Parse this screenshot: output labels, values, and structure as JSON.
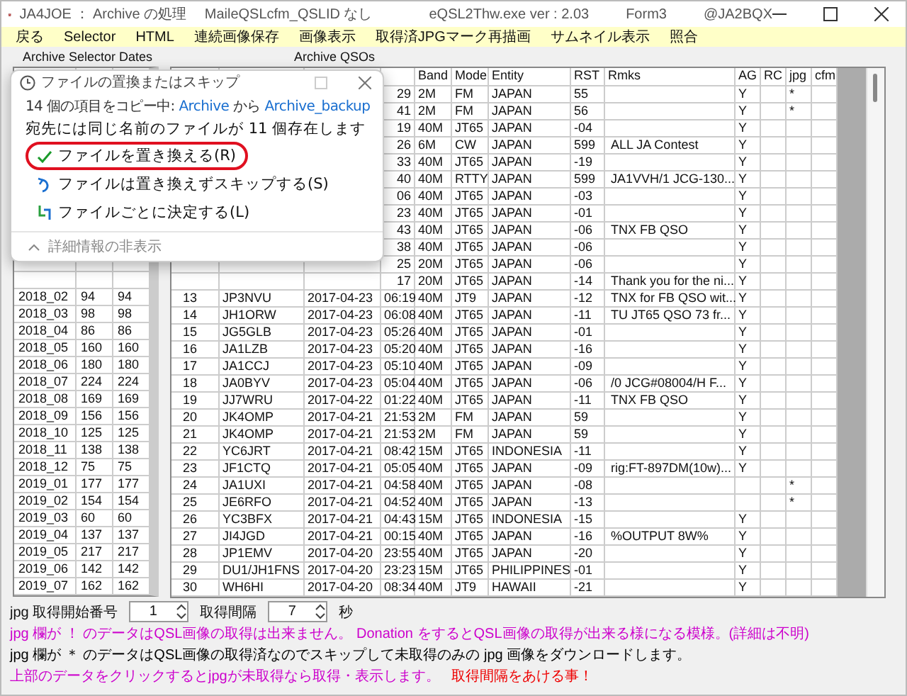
{
  "window": {
    "title_parts": [
      "JA4JOE ： Archive の処理 　MaileQSLcfm_QSLID なし",
      "eQSL2Thw.exe  ver : 2.03",
      "Form3",
      "@JA2BQX"
    ]
  },
  "menu": [
    "戻る",
    "Selector",
    "HTML",
    "連続画像保存",
    "画像表示",
    "取得済JPGマーク再描画",
    "サムネイル表示",
    "照合"
  ],
  "panel_labels": [
    "Archive Selector Dates",
    "Archive QSOs"
  ],
  "dates_table": {
    "rows": [
      [
        "2018_02",
        "94",
        "94"
      ],
      [
        "2018_03",
        "98",
        "98"
      ],
      [
        "2018_04",
        "86",
        "86"
      ],
      [
        "2018_05",
        "160",
        "160"
      ],
      [
        "2018_06",
        "180",
        "180"
      ],
      [
        "2018_07",
        "224",
        "224"
      ],
      [
        "2018_08",
        "169",
        "169"
      ],
      [
        "2018_09",
        "156",
        "156"
      ],
      [
        "2018_10",
        "125",
        "125"
      ],
      [
        "2018_11",
        "138",
        "138"
      ],
      [
        "2018_12",
        "75",
        "75"
      ],
      [
        "2019_01",
        "177",
        "177"
      ],
      [
        "2019_02",
        "154",
        "154"
      ],
      [
        "2019_03",
        "60",
        "60"
      ],
      [
        "2019_04",
        "137",
        "137"
      ],
      [
        "2019_05",
        "217",
        "217"
      ],
      [
        "2019_06",
        "142",
        "142"
      ],
      [
        "2019_07",
        "162",
        "162"
      ]
    ]
  },
  "qso_table": {
    "headers": {
      "band": "Band",
      "mode": "Mode",
      "entity": "Entity",
      "rst": "RST",
      "rmks": "Rmks",
      "ag": "AG",
      "rc": "RC",
      "jpg": "jpg",
      "cfm": "cfm"
    },
    "rows": [
      {
        "time": "29",
        "band": "2M",
        "mode": "FM",
        "entity": "JAPAN",
        "rst": "55",
        "ag": "Y",
        "jpg": "*"
      },
      {
        "time": "41",
        "band": "2M",
        "mode": "FM",
        "entity": "JAPAN",
        "rst": "56",
        "ag": "Y",
        "jpg": "*"
      },
      {
        "time": "19",
        "band": "40M",
        "mode": "JT65",
        "entity": "JAPAN",
        "rst": "-04",
        "ag": "Y"
      },
      {
        "time": "26",
        "band": "6M",
        "mode": "CW",
        "entity": "JAPAN",
        "rst": "599",
        "rmks": "ALL JA Contest",
        "ag": "Y"
      },
      {
        "time": "33",
        "band": "40M",
        "mode": "JT65",
        "entity": "JAPAN",
        "rst": "-19",
        "ag": "Y"
      },
      {
        "time": "40",
        "band": "40M",
        "mode": "RTTY",
        "entity": "JAPAN",
        "rst": "599",
        "rmks": "JA1VVH/1 JCG-130...",
        "ag": "Y"
      },
      {
        "time": "06",
        "band": "40M",
        "mode": "JT65",
        "entity": "JAPAN",
        "rst": "-03",
        "ag": "Y"
      },
      {
        "time": "23",
        "band": "40M",
        "mode": "JT65",
        "entity": "JAPAN",
        "rst": "-01",
        "ag": "Y"
      },
      {
        "time": "43",
        "band": "40M",
        "mode": "JT65",
        "entity": "JAPAN",
        "rst": "-06",
        "rmks": "TNX FB QSO",
        "ag": "Y"
      },
      {
        "time": "38",
        "band": "40M",
        "mode": "JT65",
        "entity": "JAPAN",
        "rst": "-06",
        "ag": "Y"
      },
      {
        "time": "25",
        "band": "20M",
        "mode": "JT65",
        "entity": "JAPAN",
        "rst": "-06",
        "ag": "Y"
      },
      {
        "time": "17",
        "band": "20M",
        "mode": "JT65",
        "entity": "JAPAN",
        "rst": "-14",
        "rmks": "Thank you for the ni...",
        "ag": "Y"
      },
      {
        "no": "13",
        "call": "JP3NVU",
        "date": "2017-04-23",
        "time": "06:19",
        "band": "40M",
        "mode": "JT9",
        "entity": "JAPAN",
        "rst": "-12",
        "rmks": "TNX for FB QSO wit...",
        "ag": "Y"
      },
      {
        "no": "14",
        "call": "JH1ORW",
        "date": "2017-04-23",
        "time": "06:08",
        "band": "40M",
        "mode": "JT65",
        "entity": "JAPAN",
        "rst": "-11",
        "rmks": "TU JT65 QSO 73 fr...",
        "ag": "Y"
      },
      {
        "no": "15",
        "call": "JG5GLB",
        "date": "2017-04-23",
        "time": "05:26",
        "band": "40M",
        "mode": "JT65",
        "entity": "JAPAN",
        "rst": "-01",
        "ag": "Y"
      },
      {
        "no": "16",
        "call": "JA1LZB",
        "date": "2017-04-23",
        "time": "05:20",
        "band": "40M",
        "mode": "JT65",
        "entity": "JAPAN",
        "rst": "-16",
        "ag": "Y"
      },
      {
        "no": "17",
        "call": "JA1CCJ",
        "date": "2017-04-23",
        "time": "05:10",
        "band": "40M",
        "mode": "JT65",
        "entity": "JAPAN",
        "rst": "-09",
        "ag": "Y"
      },
      {
        "no": "18",
        "call": "JA0BYV",
        "date": "2017-04-23",
        "time": "05:04",
        "band": "40M",
        "mode": "JT65",
        "entity": "JAPAN",
        "rst": "-06",
        "rmks": "/0 JCG#08004/H  F...",
        "ag": "Y"
      },
      {
        "no": "19",
        "call": "JJ7WRU",
        "date": "2017-04-22",
        "time": "01:22",
        "band": "40M",
        "mode": "JT65",
        "entity": "JAPAN",
        "rst": "-11",
        "rmks": "TNX FB QSO",
        "ag": "Y"
      },
      {
        "no": "20",
        "call": "JK4OMP",
        "date": "2017-04-21",
        "time": "21:53",
        "band": "2M",
        "mode": "FM",
        "entity": "JAPAN",
        "rst": "59",
        "ag": "Y"
      },
      {
        "no": "21",
        "call": "JK4OMP",
        "date": "2017-04-21",
        "time": "21:53",
        "band": "2M",
        "mode": "FM",
        "entity": "JAPAN",
        "rst": "59",
        "ag": "Y"
      },
      {
        "no": "22",
        "call": "YC6JRT",
        "date": "2017-04-21",
        "time": "08:42",
        "band": "15M",
        "mode": "JT65",
        "entity": "INDONESIA",
        "rst": "-11",
        "ag": "Y"
      },
      {
        "no": "23",
        "call": "JF1CTQ",
        "date": "2017-04-21",
        "time": "05:05",
        "band": "40M",
        "mode": "JT65",
        "entity": "JAPAN",
        "rst": "-09",
        "rmks": "rig:FT-897DM(10w)...",
        "ag": "Y"
      },
      {
        "no": "24",
        "call": "JA1UXI",
        "date": "2017-04-21",
        "time": "04:58",
        "band": "40M",
        "mode": "JT65",
        "entity": "JAPAN",
        "rst": "-08",
        "jpg": "*"
      },
      {
        "no": "25",
        "call": "JE6RFO",
        "date": "2017-04-21",
        "time": "04:52",
        "band": "40M",
        "mode": "JT65",
        "entity": "JAPAN",
        "rst": "-13",
        "jpg": "*"
      },
      {
        "no": "26",
        "call": "YC3BFX",
        "date": "2017-04-21",
        "time": "04:43",
        "band": "15M",
        "mode": "JT65",
        "entity": "INDONESIA",
        "rst": "-15",
        "ag": "Y"
      },
      {
        "no": "27",
        "call": "JI4JGD",
        "date": "2017-04-21",
        "time": "00:15",
        "band": "40M",
        "mode": "JT65",
        "entity": "JAPAN",
        "rst": "-16",
        "rmks": "%OUTPUT 8W%",
        "ag": "Y"
      },
      {
        "no": "28",
        "call": "JP1EMV",
        "date": "2017-04-20",
        "time": "23:55",
        "band": "40M",
        "mode": "JT65",
        "entity": "JAPAN",
        "rst": "-20",
        "ag": "Y"
      },
      {
        "no": "29",
        "call": "DU1/JH1FNS",
        "date": "2017-04-20",
        "time": "23:23",
        "band": "15M",
        "mode": "JT65",
        "entity": "PHILIPPINES",
        "rst": "-01",
        "ag": "Y"
      },
      {
        "no": "30",
        "call": "WH6HI",
        "date": "2017-04-20",
        "time": "08:34",
        "band": "40M",
        "mode": "JT9",
        "entity": "HAWAII",
        "rst": "-21",
        "ag": "Y"
      }
    ]
  },
  "controls": [
    {
      "label": "jpg 取得開始番号",
      "value": "1"
    },
    {
      "label": "取得間隔",
      "value": "7",
      "unit": "秒"
    }
  ],
  "notes": [
    {
      "text": "jpg 欄が ！ のデータはQSL画像の取得は出来ません。 Donation をするとQSL画像の取得が出来る様になる模様。(詳細は不明)",
      "color": "#cc00cc"
    },
    {
      "text": "jpg 欄が ＊ のデータはQSL画像の取得済なのでスキップして未取得のみの jpg 画像をダウンロードします。",
      "color": "#000000"
    },
    {
      "text": "上部のデータをクリックするとjpgが未取得なら取得・表示します。",
      "color": "#cc00cc"
    },
    {
      "text": "取得間隔をあける事！",
      "color": "#ee0000"
    }
  ],
  "dialog": {
    "title": "ファイルの置換またはスキップ",
    "copy_prefix": "14 個の項目をコピー中: ",
    "source": "Archive",
    "between": " から ",
    "destination": "Archive_backup",
    "heading": "宛先には同じ名前のファイルが 11 個存在します",
    "options": [
      {
        "kind": "replace",
        "label": "ファイルを置き換える(R)",
        "highlighted": true
      },
      {
        "kind": "skip",
        "label": "ファイルは置き換えずスキップする(S)",
        "highlighted": false
      },
      {
        "kind": "decide",
        "label": "ファイルごとに決定する(L)",
        "highlighted": false
      }
    ],
    "details": "詳細情報の非表示"
  }
}
